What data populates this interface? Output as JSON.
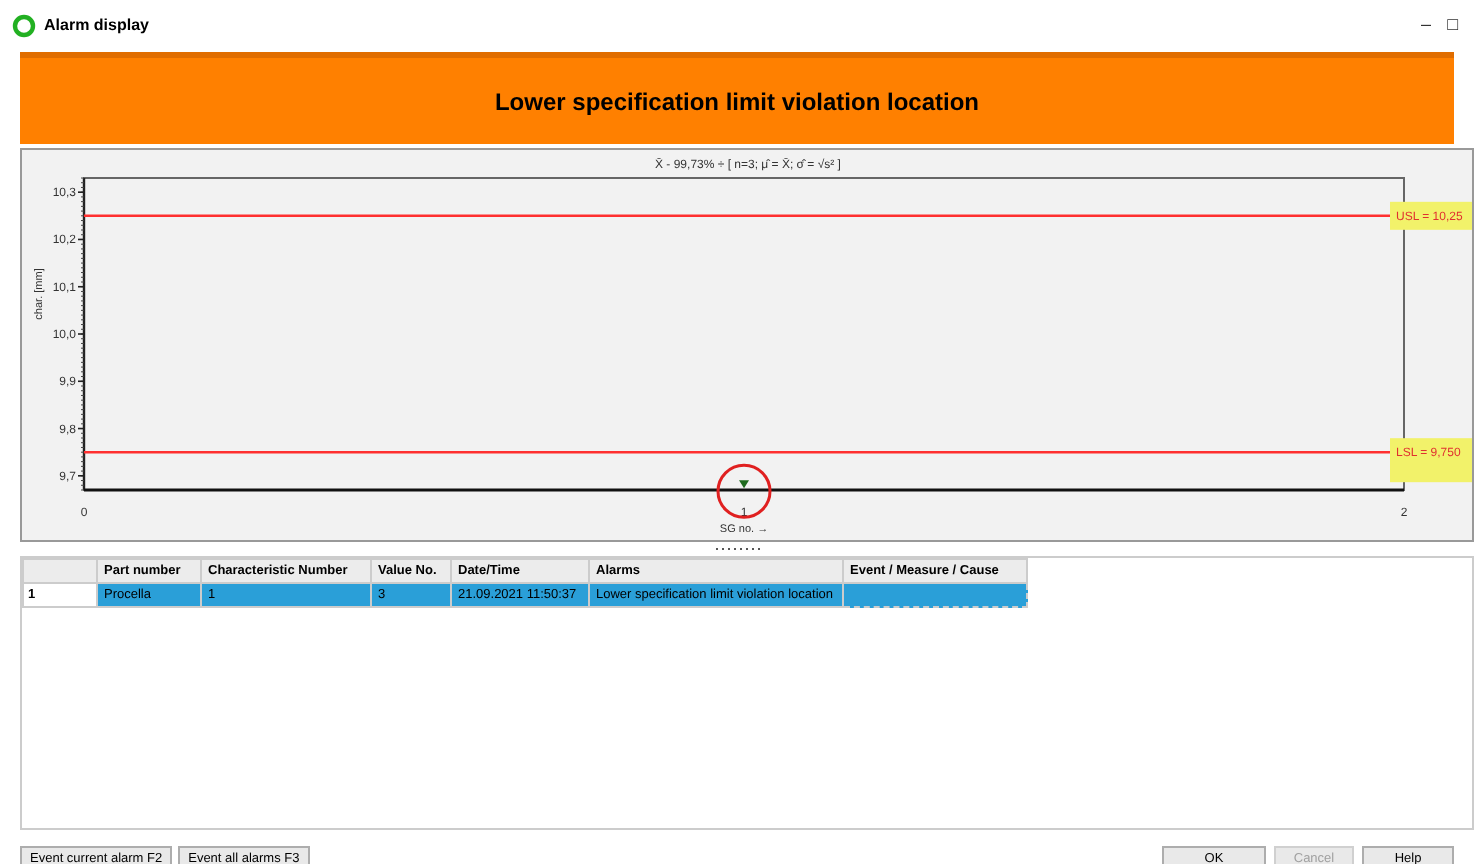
{
  "window": {
    "title": "Alarm display",
    "controls": [
      "–",
      "□"
    ]
  },
  "header": {
    "title": "Lower specification limit violation  location"
  },
  "chart": {
    "chart_data": {
      "type": "scatter",
      "title": "X̄ - 99,73% ÷ [ n=3; μ̂ = X̄; σ̂ = √s² ]",
      "xlabel": "SG no. →",
      "ylabel": "char. [mm]",
      "x": [
        1
      ],
      "series": [
        {
          "color": "#1f6b1f",
          "values": [
            9.68
          ]
        }
      ],
      "xlim": [
        0,
        2
      ],
      "ylim": [
        9.67,
        10.33
      ],
      "xticks": [
        0,
        1,
        2
      ],
      "yticks": [
        {
          "value": 9.7,
          "label": "9,7"
        },
        {
          "value": 9.8,
          "label": "9,8"
        },
        {
          "value": 9.9,
          "label": "9,9"
        },
        {
          "value": 10.0,
          "label": "10,0"
        },
        {
          "value": 10.1,
          "label": "10,1"
        },
        {
          "value": 10.2,
          "label": "10,2"
        },
        {
          "value": 10.3,
          "label": "10,3"
        }
      ],
      "ref_lines": [
        {
          "axis": "y",
          "value": 10.25,
          "label": "USL = 10,25",
          "color": "#ff3030"
        },
        {
          "axis": "y",
          "value": 9.75,
          "label": "LSL = 9,750",
          "color": "#ff3030"
        }
      ]
    }
  },
  "table": {
    "columns": [
      "Part number",
      "Characteristic Number",
      "Value No.",
      "Date/Time",
      "Alarms",
      "Event / Measure / Cause"
    ],
    "rows": [
      {
        "index": "1",
        "selected": true,
        "cells": [
          "Procella",
          "1",
          "3",
          "21.09.2021 11:50:37",
          "Lower specification limit violation  location",
          ""
        ]
      }
    ]
  },
  "buttons_left": [
    {
      "label": "Event current alarm F2",
      "disabled": false
    },
    {
      "label": "Event all alarms F3",
      "disabled": false
    }
  ],
  "buttons_right": [
    {
      "label": "OK",
      "disabled": false
    },
    {
      "label": "Cancel",
      "disabled": true
    },
    {
      "label": "Help",
      "disabled": false
    }
  ]
}
